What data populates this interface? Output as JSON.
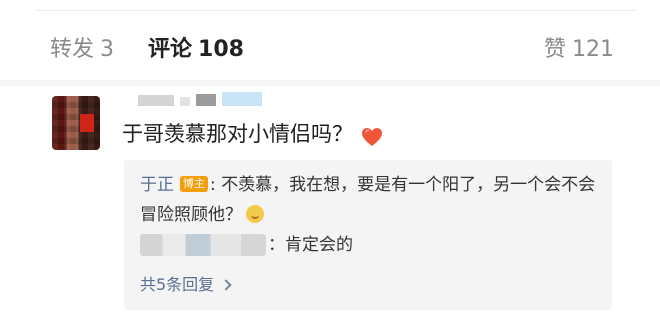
{
  "stats": {
    "forward_label": "转发",
    "forward_count": "3",
    "comment_label": "评论",
    "comment_count": "108",
    "like_label": "赞",
    "like_count": "121"
  },
  "comment": {
    "text": "于哥羡慕那对小情侣吗？",
    "emoji_icon": "red-heart-icon"
  },
  "replies": {
    "first": {
      "author": "于正",
      "badge": "博主",
      "separator": ":",
      "text": "不羡慕，我在想，要是有一个阳了，另一个会不会冒险照顾他？",
      "emoji_icon": "thinking-face-icon"
    },
    "second": {
      "separator_text": "：肯定会的"
    },
    "more_label": "共5条回复"
  },
  "colors": {
    "link_blue": "#5b6f95",
    "badge_orange": "#f59e0b",
    "heart_red": "#f0553c"
  }
}
